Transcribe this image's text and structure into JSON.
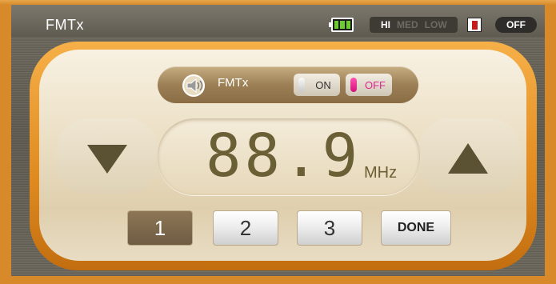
{
  "window": {
    "title": "FMTx"
  },
  "status": {
    "battery_icon": "battery-full-icon",
    "power_levels": [
      "HI",
      "MED",
      "LOW"
    ],
    "power_selected": "HI",
    "record_icon": "red-marker-icon",
    "top_toggle_label": "OFF"
  },
  "fmtx": {
    "speaker_icon": "speaker-icon",
    "label": "FMTx",
    "on_label": "ON",
    "off_label": "OFF",
    "selected": "OFF"
  },
  "tuner": {
    "frequency": "88.9",
    "unit": "MHz",
    "down_icon": "triangle-down-icon",
    "up_icon": "triangle-up-icon"
  },
  "presets": {
    "items": [
      "1",
      "2",
      "3"
    ],
    "selected": "1",
    "done_label": "DONE"
  },
  "colors": {
    "frame": "#d88a2a",
    "display_text": "#6b5f36",
    "off_accent": "#e0258f"
  }
}
